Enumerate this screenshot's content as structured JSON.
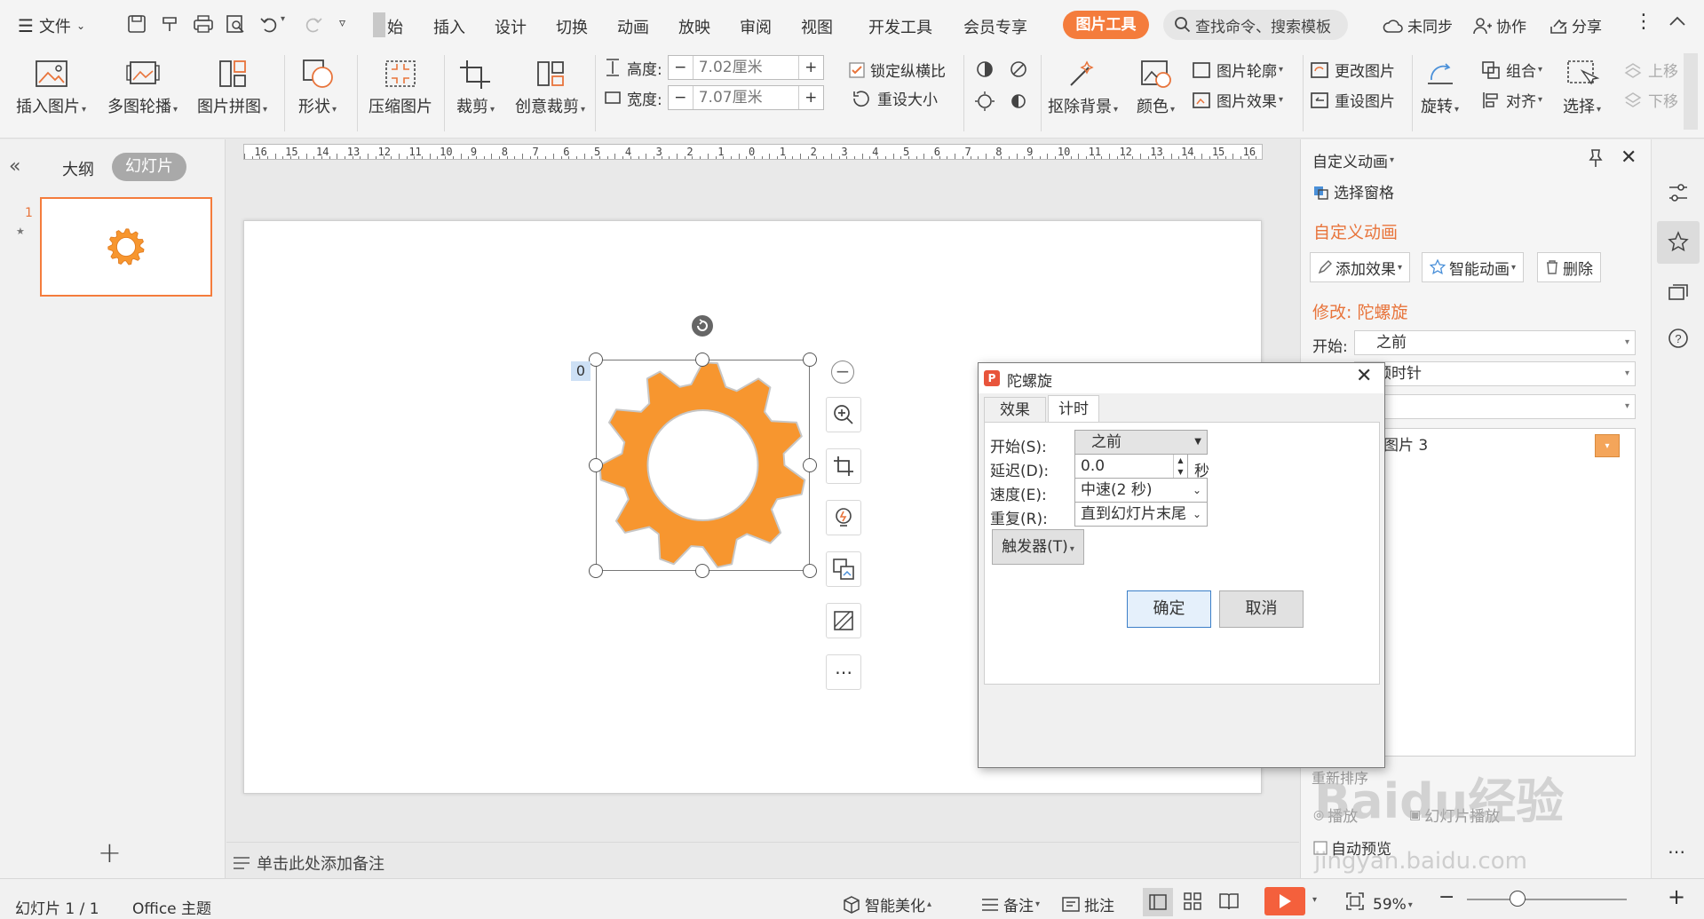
{
  "menubar": {
    "file_label": "文件",
    "tabs": [
      "始",
      "插入",
      "设计",
      "切换",
      "动画",
      "放映",
      "审阅",
      "视图",
      "开发工具",
      "会员专享"
    ],
    "active_tab": "图片工具",
    "search_placeholder": "查找命令、搜索模板",
    "sync_label": "未同步",
    "collab_label": "协作",
    "share_label": "分享"
  },
  "ribbon": {
    "insert_picture": "插入图片",
    "carousel": "多图轮播",
    "collage": "图片拼图",
    "shape": "形状",
    "compress": "压缩图片",
    "crop": "裁剪",
    "creative_crop": "创意裁剪",
    "height_label": "高度:",
    "height_value": "7.02厘米",
    "width_label": "宽度:",
    "width_value": "7.07厘米",
    "lock_ratio": "锁定纵横比",
    "reset_size": "重设大小",
    "remove_bg": "抠除背景",
    "color": "颜色",
    "outline": "图片轮廓",
    "effects": "图片效果",
    "change_picture": "更改图片",
    "reset_picture": "重设图片",
    "rotate": "旋转",
    "group": "组合",
    "align": "对齐",
    "select": "选择",
    "move_up": "上移",
    "move_down": "下移"
  },
  "leftpanel": {
    "outline_tab": "大纲",
    "slides_tab": "幻灯片",
    "slide_number": "1",
    "slide_star": "★"
  },
  "ruler": {
    "labels": [
      "16",
      "15",
      "14",
      "13",
      "12",
      "11",
      "10",
      "9",
      "8",
      "7",
      "6",
      "5",
      "4",
      "3",
      "2",
      "1",
      "0",
      "1",
      "2",
      "3",
      "4",
      "5",
      "6",
      "7",
      "8",
      "9",
      "10",
      "11",
      "12",
      "13",
      "14",
      "15",
      "16"
    ]
  },
  "slide": {
    "anim_badge": "0"
  },
  "notes": {
    "placeholder": "单击此处添加备注"
  },
  "dialog": {
    "title": "陀螺旋",
    "tab_effect": "效果",
    "tab_timing": "计时",
    "start_label": "开始(S):",
    "start_value": "之前",
    "delay_label": "延迟(D):",
    "delay_value": "0.0",
    "delay_unit": "秒",
    "speed_label": "速度(E):",
    "speed_value": "中速(2 秒)",
    "repeat_label": "重复(R):",
    "repeat_value": "直到幻灯片末尾",
    "trigger_label": "触发器(T)",
    "ok": "确定",
    "cancel": "取消"
  },
  "rightpanel": {
    "header": "自定义动画",
    "select_pane": "选择窗格",
    "section_title": "自定义动画",
    "add_effect": "添加效果",
    "smart_anim": "智能动画",
    "delete": "删除",
    "modify_label": "修改: 陀螺旋",
    "start_label": "开始:",
    "start_value": "之前",
    "direction_value": "顺时针",
    "list_item": "图片 3",
    "reorder": "重新排序",
    "play": "播放",
    "slideshow": "幻灯片播放",
    "auto_preview": "自动预览"
  },
  "statusbar": {
    "slide_info": "幻灯片 1 / 1",
    "theme": "Office 主题",
    "beautify": "智能美化",
    "notes": "备注",
    "comments": "批注",
    "zoom": "59%"
  },
  "watermark": {
    "line1": "Baidu经验",
    "line2": "jingyan.baidu.com"
  },
  "colors": {
    "accent": "#f47c3c",
    "gear": "#f7962f",
    "selection": "#4472c4"
  }
}
